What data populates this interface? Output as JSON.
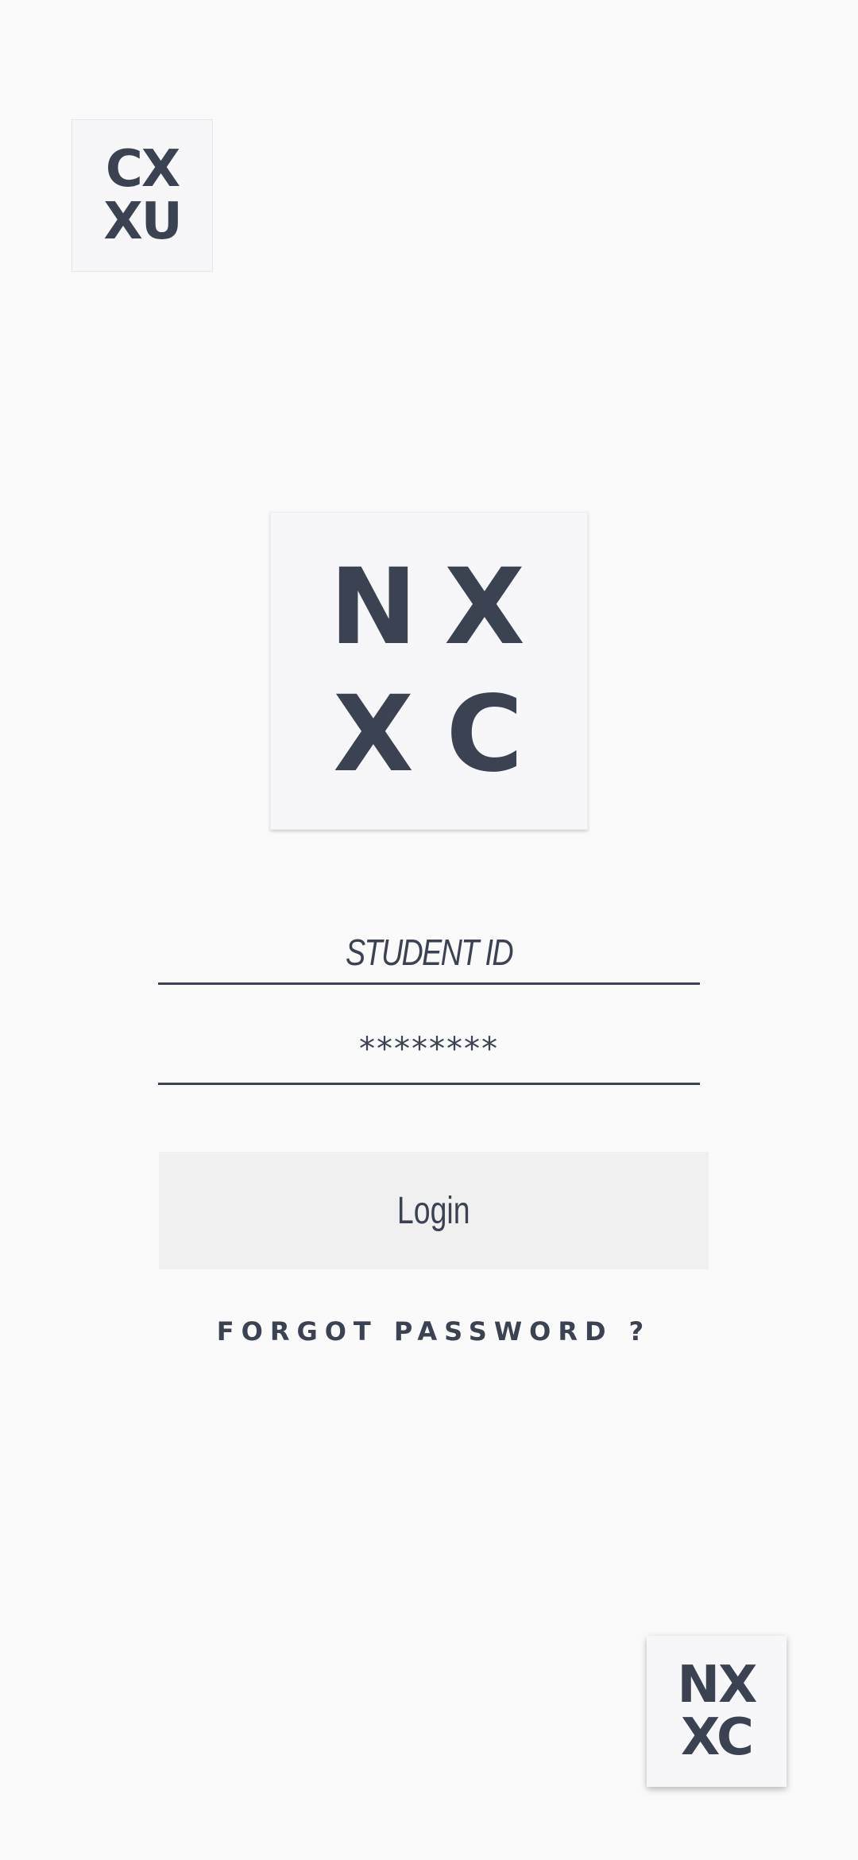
{
  "logos": {
    "top_left": {
      "row1": "CX",
      "row2": "XU"
    },
    "center": {
      "row1_left": "N",
      "row1_right": "X",
      "row2_left": "X",
      "row2_right": "C"
    },
    "bottom_right": {
      "row1": "NX",
      "row2": "XC"
    }
  },
  "form": {
    "student_id_placeholder": "STUDENT ID",
    "password_value": "********",
    "login_label": "Login",
    "forgot_password_label": "FORGOT PASSWORD ?"
  },
  "colors": {
    "background": "#fafafb",
    "text": "#3b4252",
    "button_background": "#f0f0f0"
  }
}
